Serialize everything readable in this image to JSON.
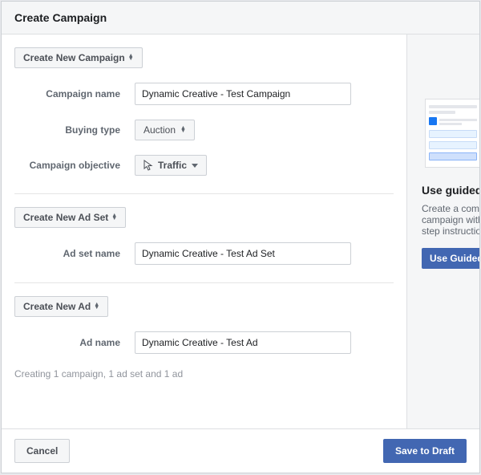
{
  "header": {
    "title": "Create Campaign"
  },
  "campaign": {
    "section_btn": "Create New Campaign",
    "name_label": "Campaign name",
    "name_value": "Dynamic Creative - Test Campaign",
    "buying_label": "Buying type",
    "buying_value": "Auction",
    "objective_label": "Campaign objective",
    "objective_value": "Traffic"
  },
  "adset": {
    "section_btn": "Create New Ad Set",
    "name_label": "Ad set name",
    "name_value": "Dynamic Creative - Test Ad Set"
  },
  "ad": {
    "section_btn": "Create New Ad",
    "name_label": "Ad name",
    "name_value": "Dynamic Creative - Test Ad"
  },
  "summary": "Creating 1 campaign, 1 ad set and 1 ad",
  "footer": {
    "cancel": "Cancel",
    "save": "Save to Draft"
  },
  "aside": {
    "title": "Use guided creation instead",
    "desc_line1": "Create a complete",
    "desc_line2": "campaign with step-by-",
    "desc_line3": "step instructions.",
    "button": "Use Guided Creation"
  }
}
